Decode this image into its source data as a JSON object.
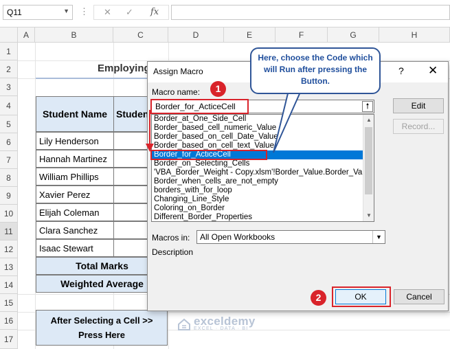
{
  "formula_bar": {
    "name_box": "Q11",
    "fx": "fx",
    "formula": ""
  },
  "columns": [
    "A",
    "B",
    "C",
    "D",
    "E",
    "F",
    "G",
    "H"
  ],
  "rows": [
    "1",
    "2",
    "3",
    "4",
    "5",
    "6",
    "7",
    "8",
    "9",
    "10",
    "11",
    "12",
    "13",
    "14",
    "15",
    "16",
    "17"
  ],
  "sheet": {
    "title": "Employing",
    "header_name": "Student Name",
    "header_c": "Studen",
    "students": [
      "Lily Henderson",
      "Hannah Martinez",
      "William Phillips",
      "Xavier Perez",
      "Elijah Coleman",
      "Clara Sanchez",
      "Isaac Stewart"
    ],
    "total_marks": "Total Marks",
    "weighted_average": "Weighted Average",
    "button_line1": "After Selecting a Cell >>",
    "button_line2": "Press Here"
  },
  "watermark": {
    "name": "exceldemy",
    "sub": "EXCEL · DATA · BI"
  },
  "dialog": {
    "title": "Assign Macro",
    "help": "?",
    "close": "✕",
    "macro_name_label": "Macro name:",
    "macro_name_value": "Border_for_ActiceCell",
    "macros": [
      "Border_at_One_Side_Cell",
      "Border_based_cell_numeric_Value",
      "Border_based_on_cell_Date_Value",
      "Border_based_on_cell_text_Value",
      "Border_for_ActiceCell",
      "Border_on_Selecting_Cells",
      "'VBA_Border_Weight - Copy.xlsm'!Border_Value.Border_Value",
      "Border_when_cells_are_not_empty",
      "borders_with_for_loop",
      "Changing_Line_Style",
      "Coloring_on_Border",
      "Different_Border_Properties"
    ],
    "selected_index": 4,
    "edit_button": "Edit",
    "record_button": "Record...",
    "macros_in_label": "Macros in:",
    "macros_in_value": "All Open Workbooks",
    "description_label": "Description",
    "ok_button": "OK",
    "cancel_button": "Cancel"
  },
  "annotations": {
    "callout": "Here, choose the Code which will Run after pressing the Button.",
    "step1": "1",
    "step2": "2"
  },
  "colors": {
    "accent_red": "#d9232a",
    "selection_blue": "#0078d7",
    "callout_blue": "#2f5597",
    "header_fill": "#dde9f6"
  }
}
